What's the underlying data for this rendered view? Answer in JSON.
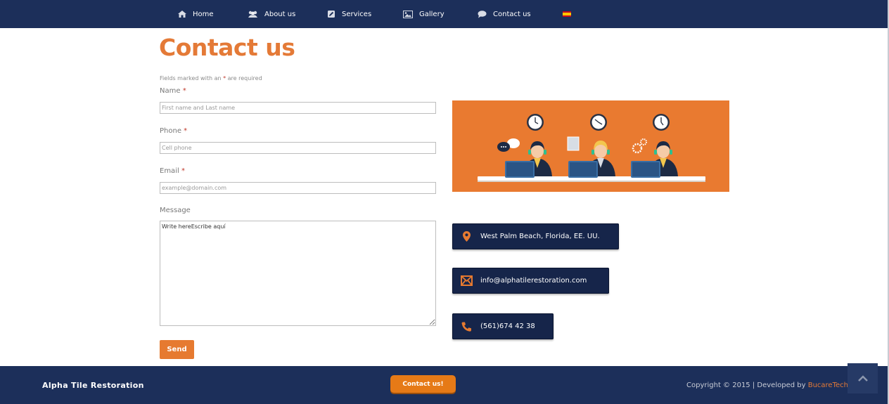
{
  "nav": {
    "items": [
      {
        "label": "Home",
        "icon": "home-icon"
      },
      {
        "label": "About us",
        "icon": "users-icon"
      },
      {
        "label": "Services",
        "icon": "edit-icon"
      },
      {
        "label": "Gallery",
        "icon": "image-icon"
      },
      {
        "label": "Contact us",
        "icon": "speech-bubble-icon"
      }
    ],
    "language_flag": "spain-flag-icon"
  },
  "page": {
    "title": "Contact us",
    "required_note_prefix": "Fields marked with an",
    "required_note_star": "*",
    "required_note_suffix": "are required"
  },
  "form": {
    "name": {
      "label": "Name",
      "required_mark": "*",
      "placeholder": "First name and Last name",
      "value": ""
    },
    "phone": {
      "label": "Phone",
      "required_mark": "*",
      "placeholder": "Cell phone",
      "value": ""
    },
    "email": {
      "label": "Email",
      "required_mark": "*",
      "placeholder": "example@domain.com",
      "value": ""
    },
    "message": {
      "label": "Message",
      "value": "Write hereEscribe aquí"
    },
    "send_label": "Send"
  },
  "contact": {
    "address": "West Palm Beach, Florida, EE. UU.",
    "email": "info@alphatilerestoration.com",
    "phone": "(561)674 42 38"
  },
  "footer": {
    "brand": "Alpha Tile Restoration",
    "cta_label": "Contact us!",
    "copyright": "Copyright © 2015 | Developed by",
    "developer": "BucareTech"
  },
  "colors": {
    "nav_bg": "#1c2f5a",
    "accent": "#e47a37",
    "button_orange": "#e67a30",
    "info_bg": "#16254a"
  }
}
